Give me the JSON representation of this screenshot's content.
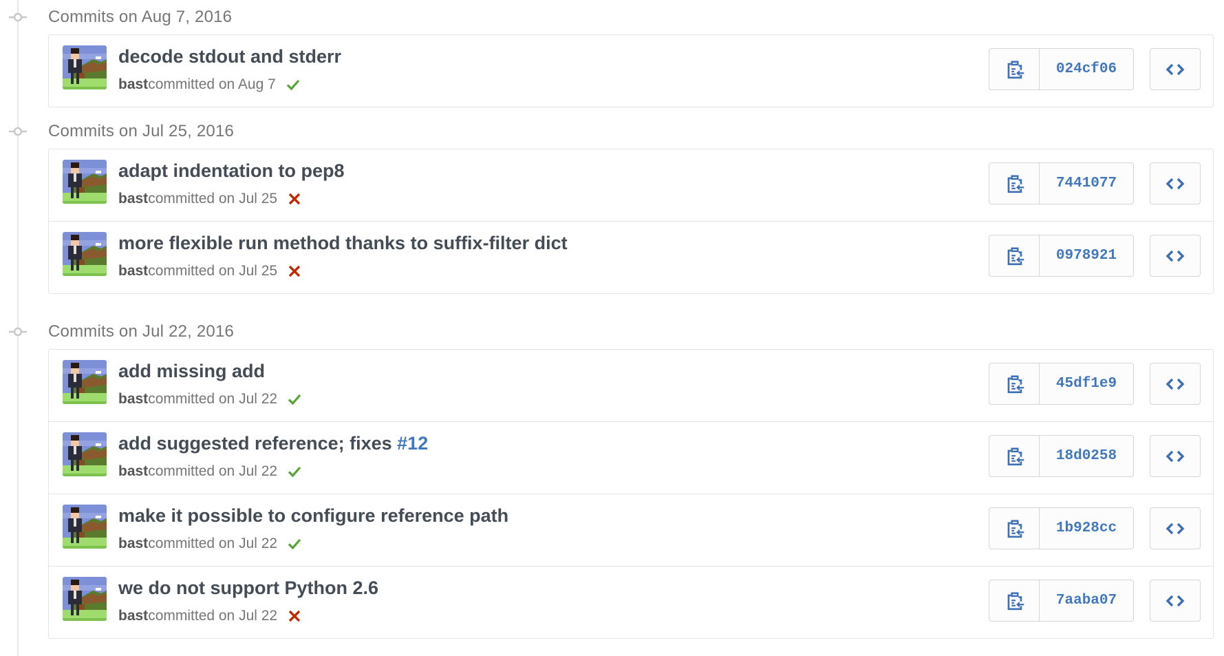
{
  "colors": {
    "accent": "#4078c0",
    "success": "#55a532",
    "failure": "#bd2c00",
    "muted": "#767676"
  },
  "icons": {
    "timeline": "git-commit-icon",
    "copy": "clippy-icon",
    "browse": "code-icon",
    "success": "check-icon",
    "failure": "x-icon"
  },
  "groups": [
    {
      "title": "Commits on Aug 7, 2016",
      "commits": [
        {
          "message": "decode stdout and stderr",
          "issue": "",
          "author": "bast",
          "meta": " committed on Aug 7",
          "status": "success",
          "sha": "024cf06"
        }
      ]
    },
    {
      "title": "Commits on Jul 25, 2016",
      "commits": [
        {
          "message": "adapt indentation to pep8",
          "issue": "",
          "author": "bast",
          "meta": " committed on Jul 25",
          "status": "failure",
          "sha": "7441077"
        },
        {
          "message": "more flexible run method thanks to suffix-filter dict",
          "issue": "",
          "author": "bast",
          "meta": " committed on Jul 25",
          "status": "failure",
          "sha": "0978921"
        }
      ]
    },
    {
      "title": "Commits on Jul 22, 2016",
      "commits": [
        {
          "message": "add missing add",
          "issue": "",
          "author": "bast",
          "meta": " committed on Jul 22",
          "status": "success",
          "sha": "45df1e9"
        },
        {
          "message": "add suggested reference; fixes ",
          "issue": "#12",
          "author": "bast",
          "meta": " committed on Jul 22",
          "status": "success",
          "sha": "18d0258"
        },
        {
          "message": "make it possible to configure reference path",
          "issue": "",
          "author": "bast",
          "meta": " committed on Jul 22",
          "status": "success",
          "sha": "1b928cc"
        },
        {
          "message": "we do not support Python 2.6",
          "issue": "",
          "author": "bast",
          "meta": " committed on Jul 22",
          "status": "failure",
          "sha": "7aaba07"
        }
      ]
    }
  ]
}
